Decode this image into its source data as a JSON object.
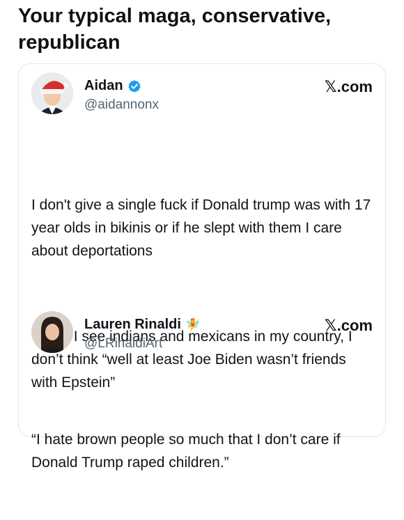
{
  "headline": "Your typical maga, conservative, republican",
  "posts": [
    {
      "display_name": "Aidan",
      "handle": "@aidannonx",
      "verified": true,
      "avatar_icon": "santa-hat-avatar-icon",
      "site_label": ".com",
      "site_icon": "x-logo-icon",
      "paragraphs": [
        "I don't give a single fuck if Donald trump was with 17 year olds in bikinis or if he slept with them I care about deportations",
        "When I see indians and mexicans in my country, I don’t think “well at least Joe Biden wasn’t friends with Epstein”"
      ]
    },
    {
      "display_name": "Lauren Rinaldi",
      "handle": "@LRinaldiArt",
      "name_emoji": "🧚",
      "avatar_icon": "woman-portrait-avatar-icon",
      "site_label": ".com",
      "site_icon": "x-logo-icon",
      "paragraphs": [
        "“I hate brown people so much that I don’t care if Donald Trump raped children.”"
      ]
    }
  ],
  "colors": {
    "verified_blue": "#1d9bf0",
    "handle_gray": "#536471",
    "card_border": "#e3e6ea"
  }
}
